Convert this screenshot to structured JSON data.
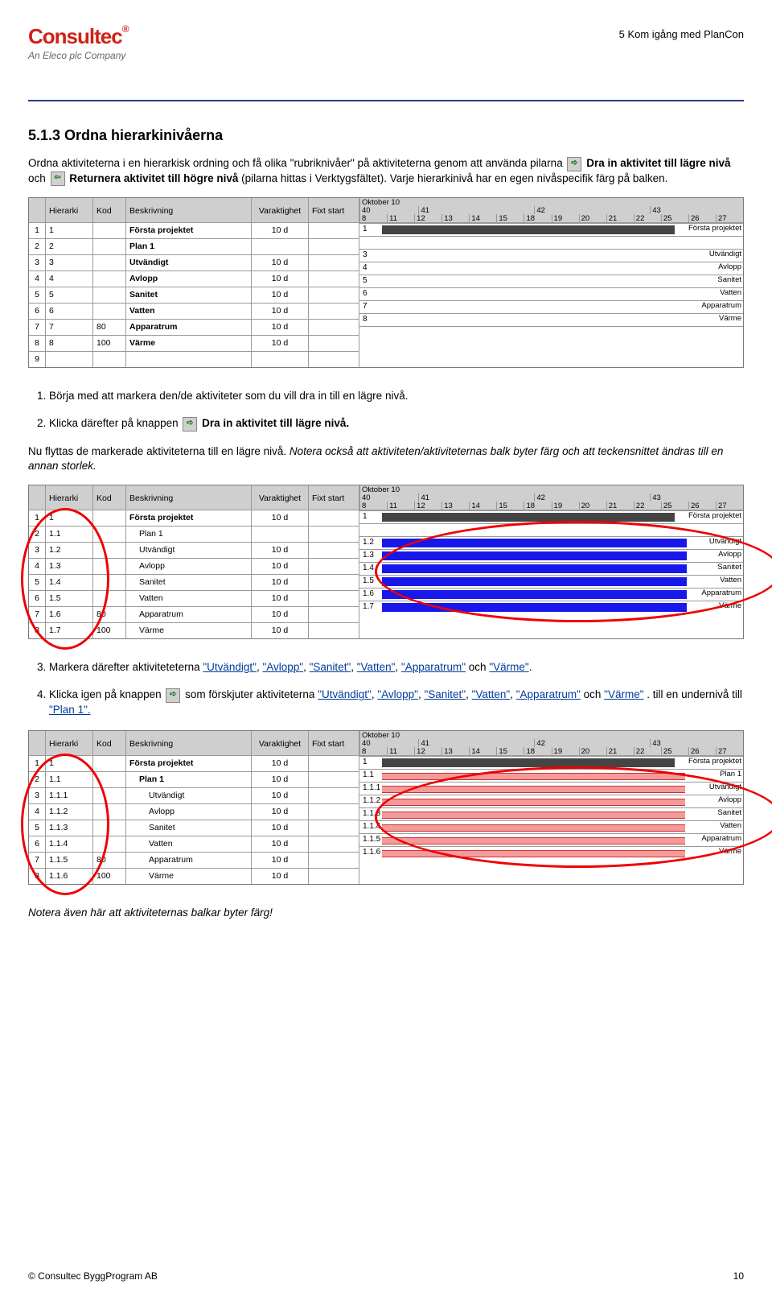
{
  "header": {
    "right": "5 Kom igång med PlanCon",
    "logo_sub": "An Eleco plc Company"
  },
  "h2": "5.1.3  Ordna hierarkinivåerna",
  "p1a": "Ordna aktiviteterna i en hierarkisk ordning och få olika \"rubriknivåer\" på aktiviteterna genom att använda pilarna ",
  "p1b": " Dra in aktivitet till lägre nivå",
  "p1c": " och ",
  "p1d": " Returnera aktivitet till högre nivå",
  "p1e": " (pilarna hittas i Verktygsfältet). Varje hierarkinivå har en egen nivåspecifik färg på balken.",
  "ol1_1": "Börja med att markera den/de aktiviteter som du vill dra in till en lägre nivå.",
  "ol1_2a": "Klicka därefter på knappen ",
  "ol1_2b": " Dra in aktivitet till lägre nivå.",
  "p2": "Nu flyttas de markerade aktiviteterna till en lägre nivå. ",
  "p2i": "Notera också att aktiviteten/aktiviteternas balk byter färg och att teckensnittet ändras till en annan storlek.",
  "ol2_3a": "Markera därefter aktiviteteterna ",
  "ol2_3b": " och ",
  "ol2_4a": "Klicka igen på knappen ",
  "ol2_4b": " som förskjuter aktiviteterna ",
  "ol2_4c": " och ",
  "ol2_4d": ". till en undernivå till ",
  "terms": [
    "\"Utvändigt\"",
    "\"Avlopp\"",
    "\"Sanitet\"",
    "\"Vatten\"",
    "\"Apparatrum\"",
    "\"Värme\""
  ],
  "plan1": "\"Plan 1\".",
  "p_last": "Notera även här att aktiviteternas balkar byter färg!",
  "footer_left": "© Consultec ByggProgram AB",
  "footer_right": "10",
  "cols": {
    "h": "Hierarki",
    "k": "Kod",
    "b": "Beskrivning",
    "v": "Varaktighet",
    "f": "Fixt start"
  },
  "gantt_head": {
    "month": "Oktober 10",
    "weeks": [
      "40",
      "41",
      "42",
      "43"
    ],
    "days": [
      "8",
      "11",
      "12",
      "13",
      "14",
      "15",
      "18",
      "19",
      "20",
      "21",
      "22",
      "25",
      "26",
      "27"
    ]
  },
  "shot1_rows": [
    {
      "n": "1",
      "h": "1",
      "k": "",
      "b": "Första projektet",
      "v": "10 d",
      "gl": "1",
      "lab": "Första projektet"
    },
    {
      "n": "2",
      "h": "2",
      "k": "",
      "b": "Plan 1",
      "v": "",
      "gl": "",
      "lab": ""
    },
    {
      "n": "3",
      "h": "3",
      "k": "",
      "b": "Utvändigt",
      "v": "10 d",
      "gl": "3",
      "lab": "Utvändigt"
    },
    {
      "n": "4",
      "h": "4",
      "k": "",
      "b": "Avlopp",
      "v": "10 d",
      "gl": "4",
      "lab": "Avlopp"
    },
    {
      "n": "5",
      "h": "5",
      "k": "",
      "b": "Sanitet",
      "v": "10 d",
      "gl": "5",
      "lab": "Sanitet"
    },
    {
      "n": "6",
      "h": "6",
      "k": "",
      "b": "Vatten",
      "v": "10 d",
      "gl": "6",
      "lab": "Vatten"
    },
    {
      "n": "7",
      "h": "7",
      "k": "80",
      "b": "Apparatrum",
      "v": "10 d",
      "gl": "7",
      "lab": "Apparatrum"
    },
    {
      "n": "8",
      "h": "8",
      "k": "100",
      "b": "Värme",
      "v": "10 d",
      "gl": "8",
      "lab": "Värme"
    },
    {
      "n": "9",
      "h": "",
      "k": "",
      "b": "",
      "v": "",
      "gl": "",
      "lab": ""
    }
  ],
  "shot2_rows": [
    {
      "n": "1",
      "h": "1",
      "k": "",
      "b": "Första projektet",
      "v": "10 d",
      "gl": "1",
      "lab": "Första projektet"
    },
    {
      "n": "2",
      "h": "1.1",
      "k": "",
      "b": "Plan 1",
      "v": "",
      "gl": "",
      "lab": ""
    },
    {
      "n": "3",
      "h": "1.2",
      "k": "",
      "b": "Utvändigt",
      "v": "10 d",
      "gl": "1.2",
      "lab": "Utvändigt"
    },
    {
      "n": "4",
      "h": "1.3",
      "k": "",
      "b": "Avlopp",
      "v": "10 d",
      "gl": "1.3",
      "lab": "Avlopp"
    },
    {
      "n": "5",
      "h": "1.4",
      "k": "",
      "b": "Sanitet",
      "v": "10 d",
      "gl": "1.4",
      "lab": "Sanitet"
    },
    {
      "n": "6",
      "h": "1.5",
      "k": "",
      "b": "Vatten",
      "v": "10 d",
      "gl": "1.5",
      "lab": "Vatten"
    },
    {
      "n": "7",
      "h": "1.6",
      "k": "80",
      "b": "Apparatrum",
      "v": "10 d",
      "gl": "1.6",
      "lab": "Apparatrum"
    },
    {
      "n": "8",
      "h": "1.7",
      "k": "100",
      "b": "Värme",
      "v": "10 d",
      "gl": "1.7",
      "lab": "Värme"
    }
  ],
  "shot3_rows": [
    {
      "n": "1",
      "h": "1",
      "k": "",
      "b": "Första projektet",
      "v": "10 d",
      "gl": "1",
      "lab": "Första projektet"
    },
    {
      "n": "2",
      "h": "1.1",
      "k": "",
      "b": "Plan 1",
      "v": "10 d",
      "gl": "1.1",
      "lab": "Plan 1"
    },
    {
      "n": "3",
      "h": "1.1.1",
      "k": "",
      "b": "Utvändigt",
      "v": "10 d",
      "gl": "1.1.1",
      "lab": "Utvändigt"
    },
    {
      "n": "4",
      "h": "1.1.2",
      "k": "",
      "b": "Avlopp",
      "v": "10 d",
      "gl": "1.1.2",
      "lab": "Avlopp"
    },
    {
      "n": "5",
      "h": "1.1.3",
      "k": "",
      "b": "Sanitet",
      "v": "10 d",
      "gl": "1.1.3",
      "lab": "Sanitet"
    },
    {
      "n": "6",
      "h": "1.1.4",
      "k": "",
      "b": "Vatten",
      "v": "10 d",
      "gl": "1.1.4",
      "lab": "Vatten"
    },
    {
      "n": "7",
      "h": "1.1.5",
      "k": "80",
      "b": "Apparatrum",
      "v": "10 d",
      "gl": "1.1.5",
      "lab": "Apparatrum"
    },
    {
      "n": "8",
      "h": "1.1.6",
      "k": "100",
      "b": "Värme",
      "v": "10 d",
      "gl": "1.1.6",
      "lab": "Värme"
    }
  ],
  "icon_right": "➪",
  "icon_left": "⇦"
}
